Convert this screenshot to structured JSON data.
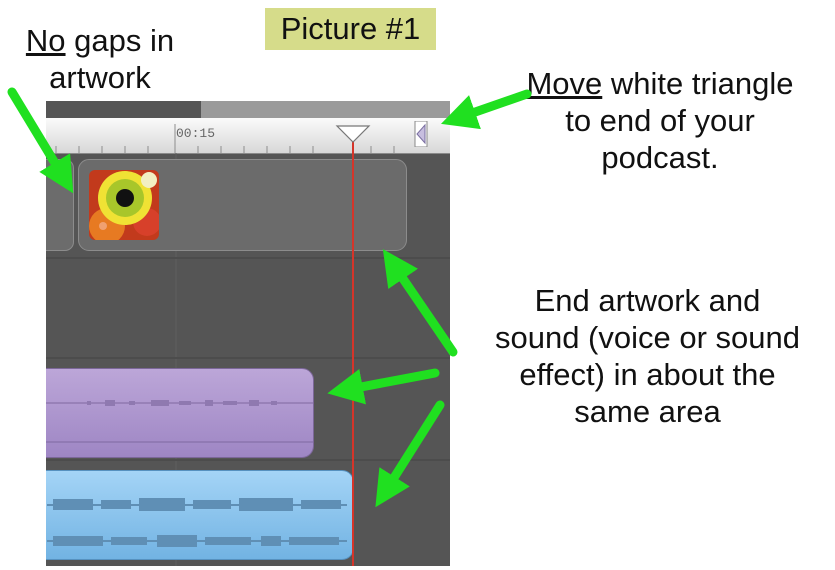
{
  "title": "Picture #1",
  "annotations": {
    "no_gaps_underlined": "No",
    "no_gaps_line1_rest": " gaps in",
    "no_gaps_line2": "artwork",
    "move_underlined": "Move",
    "move_line1_rest": " white triangle",
    "move_line2": "to end of your",
    "move_line3": "podcast.",
    "end_line1": "End artwork and",
    "end_line2": "sound (voice or sound",
    "end_line3": "effect) in about the",
    "end_line4": "same area"
  },
  "timeline": {
    "ruler_time": "00:15"
  },
  "colors": {
    "arrow": "#20e020",
    "playhead": "#d5352a",
    "voice_track": "#b09bd3",
    "sound_track": "#8cc6f0",
    "title_bg": "#d6dc8a"
  },
  "icons": [
    "playhead-triangle-icon",
    "end-marker-icon",
    "arrow-icon"
  ]
}
